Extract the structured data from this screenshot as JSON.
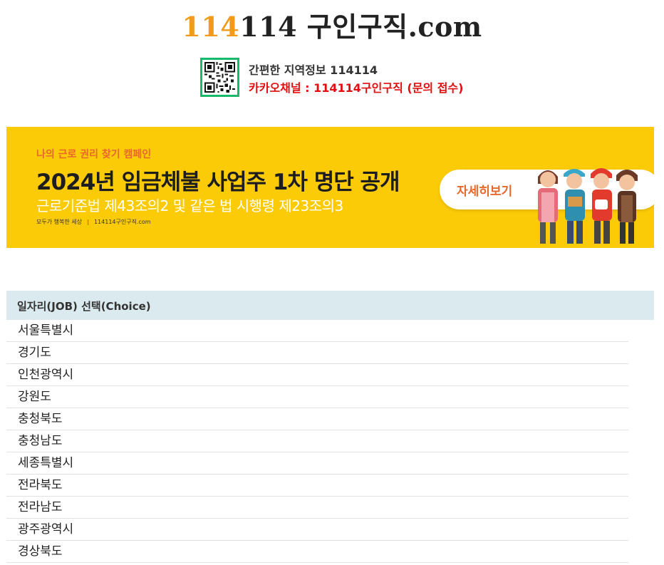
{
  "site": {
    "logo_accent": "114",
    "logo_rest": "114 구인구직.com",
    "accent_color": "#f29a1a"
  },
  "info": {
    "line1": "간편한 지역정보 114114",
    "line2": "카카오채널 : 114114구인구직 (문의 접수)"
  },
  "banner": {
    "tag": "나의 근로 권리 찾기 캠페인",
    "title": "2024년 임금체불 사업주 1차 명단 공개",
    "subtitle": "근로기준법 제43조의2 및 같은 법 시행령 제23조의3",
    "footer_left": "모두가 행복한 세상",
    "footer_right": "114114구인구직.com",
    "button_label": "자세히보기",
    "background": "#fccb08"
  },
  "job_section": {
    "header": "일자리(JOB) 선택(Choice)",
    "regions": [
      "서울특별시",
      "경기도",
      "인천광역시",
      "강원도",
      "충청북도",
      "충청남도",
      "세종특별시",
      "전라북도",
      "전라남도",
      "광주광역시",
      "경상북도"
    ]
  }
}
